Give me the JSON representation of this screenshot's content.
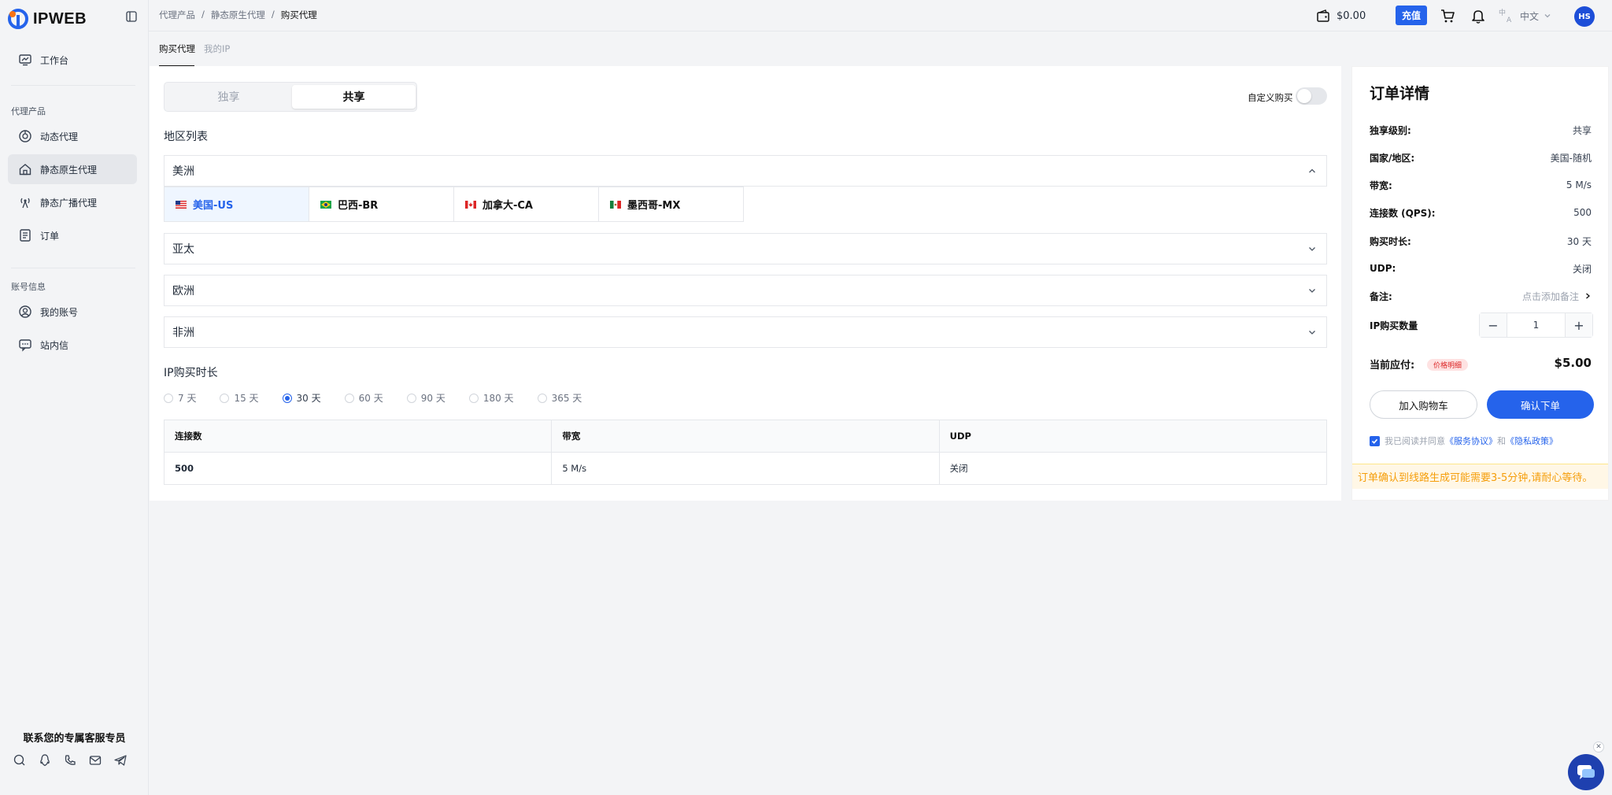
{
  "app": {
    "logo_text": "IPWEB"
  },
  "sidebar": {
    "workbench": "工作台",
    "group_products": "代理产品",
    "products": [
      {
        "label": "动态代理"
      },
      {
        "label": "静态原生代理"
      },
      {
        "label": "静态广播代理"
      },
      {
        "label": "订单"
      }
    ],
    "group_account": "账号信息",
    "account": [
      {
        "label": "我的账号"
      },
      {
        "label": "站内信"
      }
    ],
    "contact_title": "联系您的专属客服专员"
  },
  "topbar": {
    "breadcrumb": [
      "代理产品",
      "静态原生代理",
      "购买代理"
    ],
    "balance": "$0.00",
    "recharge": "充值",
    "language": "中文",
    "avatar": "HS"
  },
  "subtabs": [
    "购买代理",
    "我的IP"
  ],
  "main": {
    "segment": [
      "独享",
      "共享"
    ],
    "custom_purchase": "自定义购买",
    "region_title": "地区列表",
    "regions": [
      "美洲",
      "亚太",
      "欧洲",
      "非洲"
    ],
    "countries": [
      "美国-US",
      "巴西-BR",
      "加拿大-CA",
      "墨西哥-MX"
    ],
    "duration_title": "IP购买时长",
    "durations": [
      "7 天",
      "15 天",
      "30 天",
      "60 天",
      "90 天",
      "180 天",
      "365 天"
    ],
    "selected_duration": "30 天",
    "spec_headers": [
      "连接数",
      "带宽",
      "UDP"
    ],
    "spec_values": [
      "500",
      "5 M/s",
      "关闭"
    ]
  },
  "order": {
    "title": "订单详情",
    "rows": [
      {
        "k": "独享级别:",
        "v": "共享"
      },
      {
        "k": "国家/地区:",
        "v": "美国-随机"
      },
      {
        "k": "带宽:",
        "v": "5 M/s"
      },
      {
        "k": "连接数 (QPS):",
        "v": "500"
      },
      {
        "k": "购买时长:",
        "v": "30 天"
      },
      {
        "k": "UDP:",
        "v": "关闭"
      },
      {
        "k": "备注:",
        "v": "点击添加备注"
      }
    ],
    "qty_label": "IP购买数量",
    "qty": "1",
    "pay_label": "当前应付:",
    "price_detail": "价格明细",
    "amount": "$5.00",
    "add_cart": "加入购物车",
    "confirm": "确认下单",
    "agree_prefix": "我已阅读并同意",
    "service_link": "《服务协议》",
    "agree_and": "和",
    "privacy_link": "《隐私政策》",
    "notice": "订单确认到线路生成可能需要3-5分钟,请耐心等待。"
  },
  "colors": {
    "accent": "#2563eb",
    "notice": "#f59e0b"
  }
}
